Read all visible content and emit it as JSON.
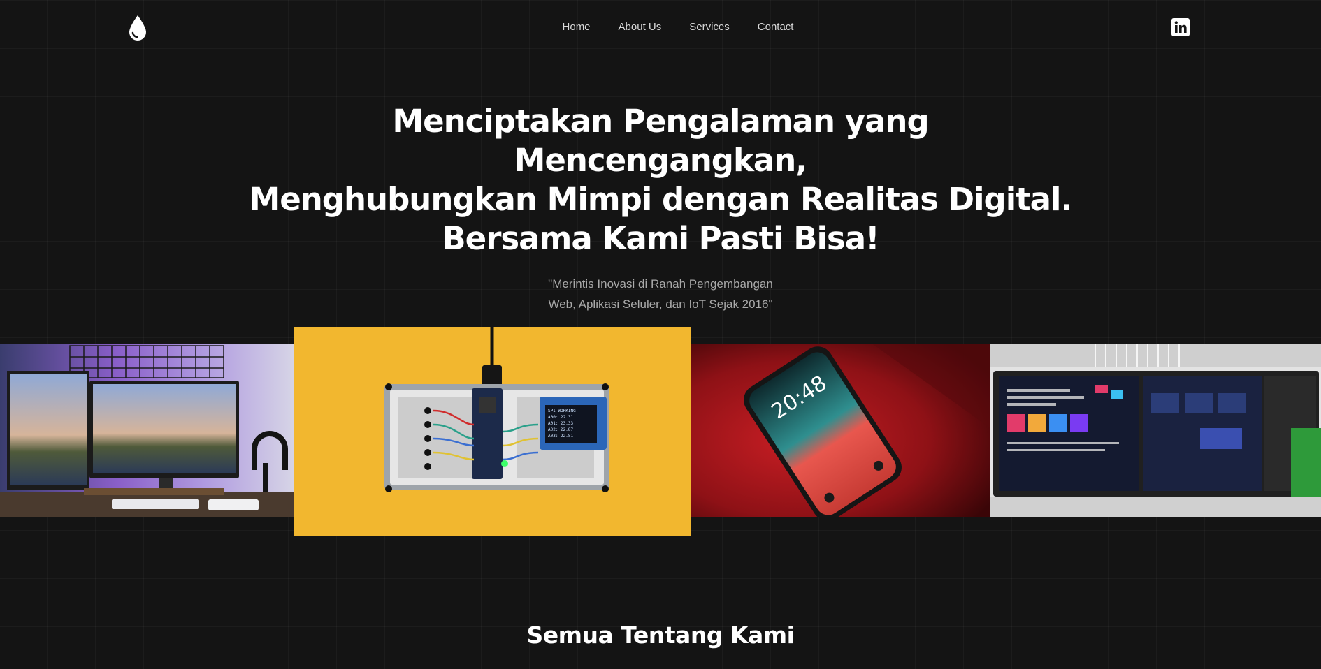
{
  "nav": {
    "links": [
      "Home",
      "About Us",
      "Services",
      "Contact"
    ]
  },
  "icons": {
    "logo": "water-drop-icon",
    "social": "linkedin-icon"
  },
  "hero": {
    "title_line1": "Menciptakan Pengalaman yang Mencengangkan,",
    "title_line2": "Menghubungkan Mimpi dengan Realitas Digital.",
    "title_line3": "Bersama Kami Pasti Bisa!",
    "subtitle_line1": "\"Merintis Inovasi di Ranah Pengembangan",
    "subtitle_line2": "Web, Aplikasi Seluler, dan IoT Sejak 2016\""
  },
  "gallery": {
    "photos": [
      "desk-setup-photo",
      "iot-breadboard-photo",
      "smartphone-photo",
      "web-design-monitor-photo"
    ],
    "phone_clock": "20:48"
  },
  "about": {
    "title": "Semua Tentang Kami"
  },
  "colors": {
    "background": "#141414",
    "text": "#ffffff",
    "muted": "#a9a9a9",
    "accent_yellow": "#f2b72f",
    "accent_red": "#b3141a"
  }
}
